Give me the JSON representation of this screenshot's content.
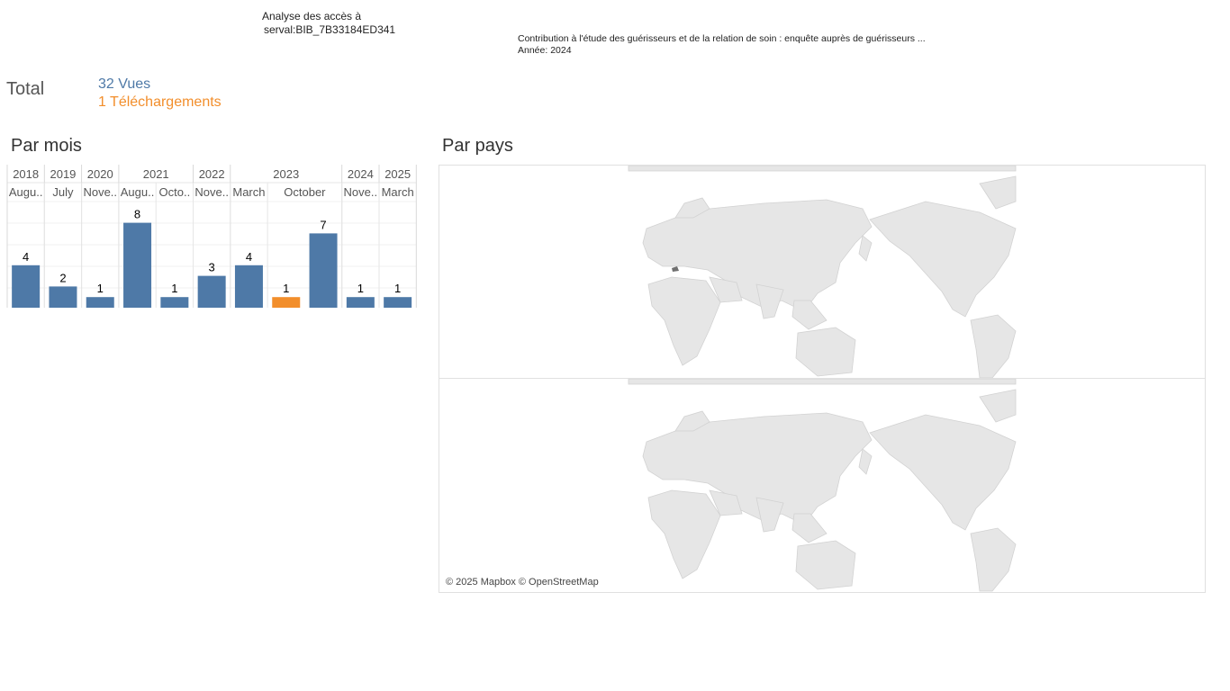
{
  "header": {
    "title_line1": "Analyse des accès à",
    "title_line2": "serval:BIB_7B33184ED341",
    "doc_title": "Contribution à l'étude des guérisseurs et de la relation de soin : enquête auprès de guérisseurs ...",
    "doc_year": "Année: 2024"
  },
  "totals": {
    "label": "Total",
    "views": "32 Vues",
    "downloads": "1 Téléchargements"
  },
  "sections": {
    "by_month": "Par mois",
    "by_country": "Par pays"
  },
  "colors": {
    "views": "#4e79a7",
    "downloads": "#f28e2b",
    "land": "#e6e6e6",
    "highlight_country": "#707070"
  },
  "chart_data": {
    "type": "bar",
    "title": "Par mois",
    "years": [
      {
        "label": "2018",
        "span": 1
      },
      {
        "label": "2019",
        "span": 1
      },
      {
        "label": "2020",
        "span": 1
      },
      {
        "label": "2021",
        "span": 2
      },
      {
        "label": "2022",
        "span": 1
      },
      {
        "label": "2023",
        "span": 3
      },
      {
        "label": "2024",
        "span": 1
      },
      {
        "label": "2025",
        "span": 1
      }
    ],
    "months": [
      {
        "label": "Augu..",
        "span": 1
      },
      {
        "label": "July",
        "span": 1
      },
      {
        "label": "Nove..",
        "span": 1
      },
      {
        "label": "Augu..",
        "span": 1
      },
      {
        "label": "Octo..",
        "span": 1
      },
      {
        "label": "Nove..",
        "span": 1
      },
      {
        "label": "March",
        "span": 1
      },
      {
        "label": "October",
        "span": 2
      },
      {
        "label": "Nove..",
        "span": 1
      },
      {
        "label": "March",
        "span": 1
      }
    ],
    "bars": [
      {
        "value": 4,
        "type": "views"
      },
      {
        "value": 2,
        "type": "views"
      },
      {
        "value": 1,
        "type": "views"
      },
      {
        "value": 8,
        "type": "views"
      },
      {
        "value": 1,
        "type": "views"
      },
      {
        "value": 3,
        "type": "views"
      },
      {
        "value": 4,
        "type": "views"
      },
      {
        "value": 1,
        "type": "downloads"
      },
      {
        "value": 7,
        "type": "views"
      },
      {
        "value": 1,
        "type": "views"
      },
      {
        "value": 1,
        "type": "views"
      }
    ],
    "ylim": [
      0,
      10
    ]
  },
  "map": {
    "attribution": "© 2025 Mapbox © OpenStreetMap",
    "highlighted_country": "Switzerland"
  }
}
